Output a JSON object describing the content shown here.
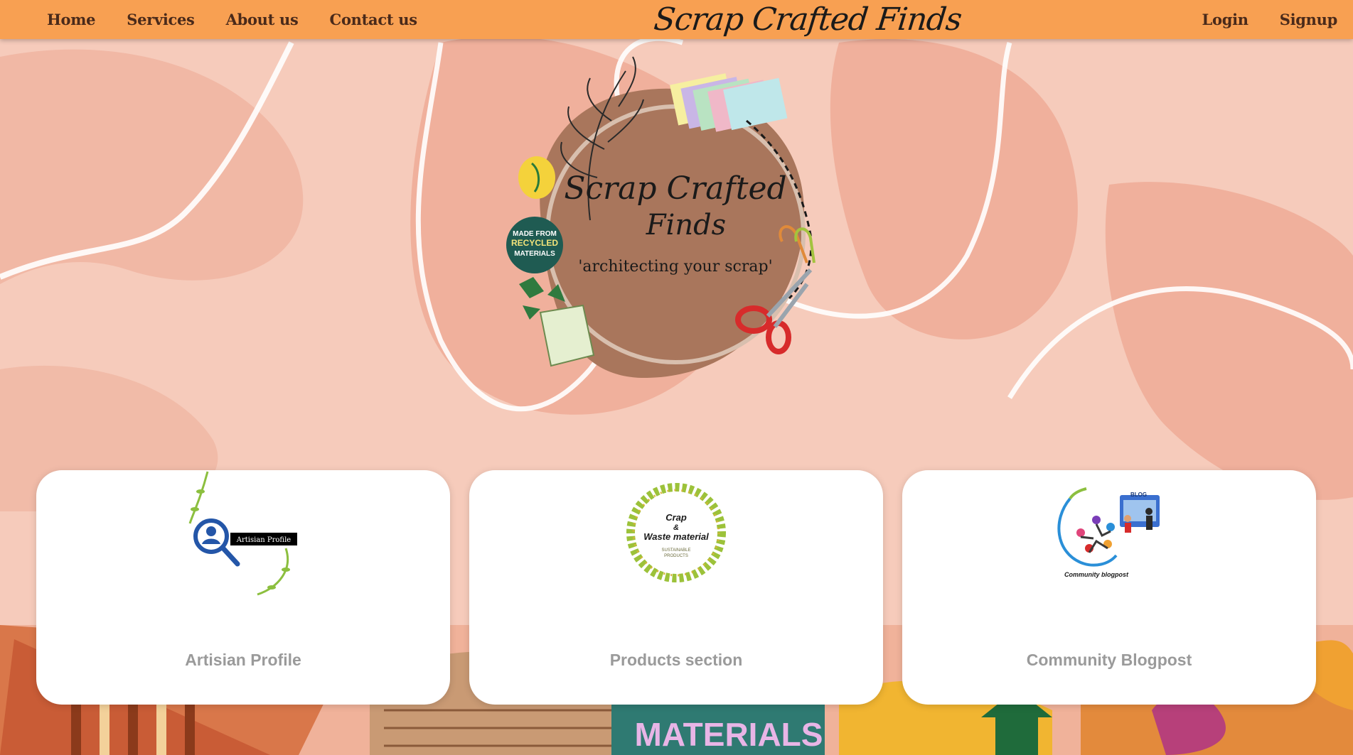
{
  "nav": {
    "left_items": [
      "Home",
      "Services",
      "About us",
      "Contact us"
    ],
    "brand": "Scrap Crafted Finds",
    "right_items": [
      "Login",
      "Signup"
    ]
  },
  "hero": {
    "logo_title_line1": "Scrap Crafted",
    "logo_title_line2": "Finds",
    "logo_tagline": "'architecting your scrap'",
    "badge_line1": "MADE FROM",
    "badge_line2": "RECYCLED",
    "badge_line3": "MATERIALS"
  },
  "cards": [
    {
      "title": "Artisian Profile",
      "image_label": "Artisian Profile"
    },
    {
      "title": "Products section",
      "image_label_line1": "Crap",
      "image_label_line2": "&",
      "image_label_line3": "Waste material",
      "image_label_line4": "SUSTAINABLE",
      "image_label_line5": "PRODUCTS"
    },
    {
      "title": "Community Blogpost",
      "image_label": "Community blogpost",
      "image_badge": "BLOG"
    }
  ],
  "background": {
    "bottom_banner_text": "MATERIALS"
  },
  "colors": {
    "navbar": "#f8a052",
    "nav_text": "#4a2a1a",
    "page_bg": "#f6c9b8",
    "card_title": "#9a9a9a",
    "logo_circle": "#a9765c"
  }
}
